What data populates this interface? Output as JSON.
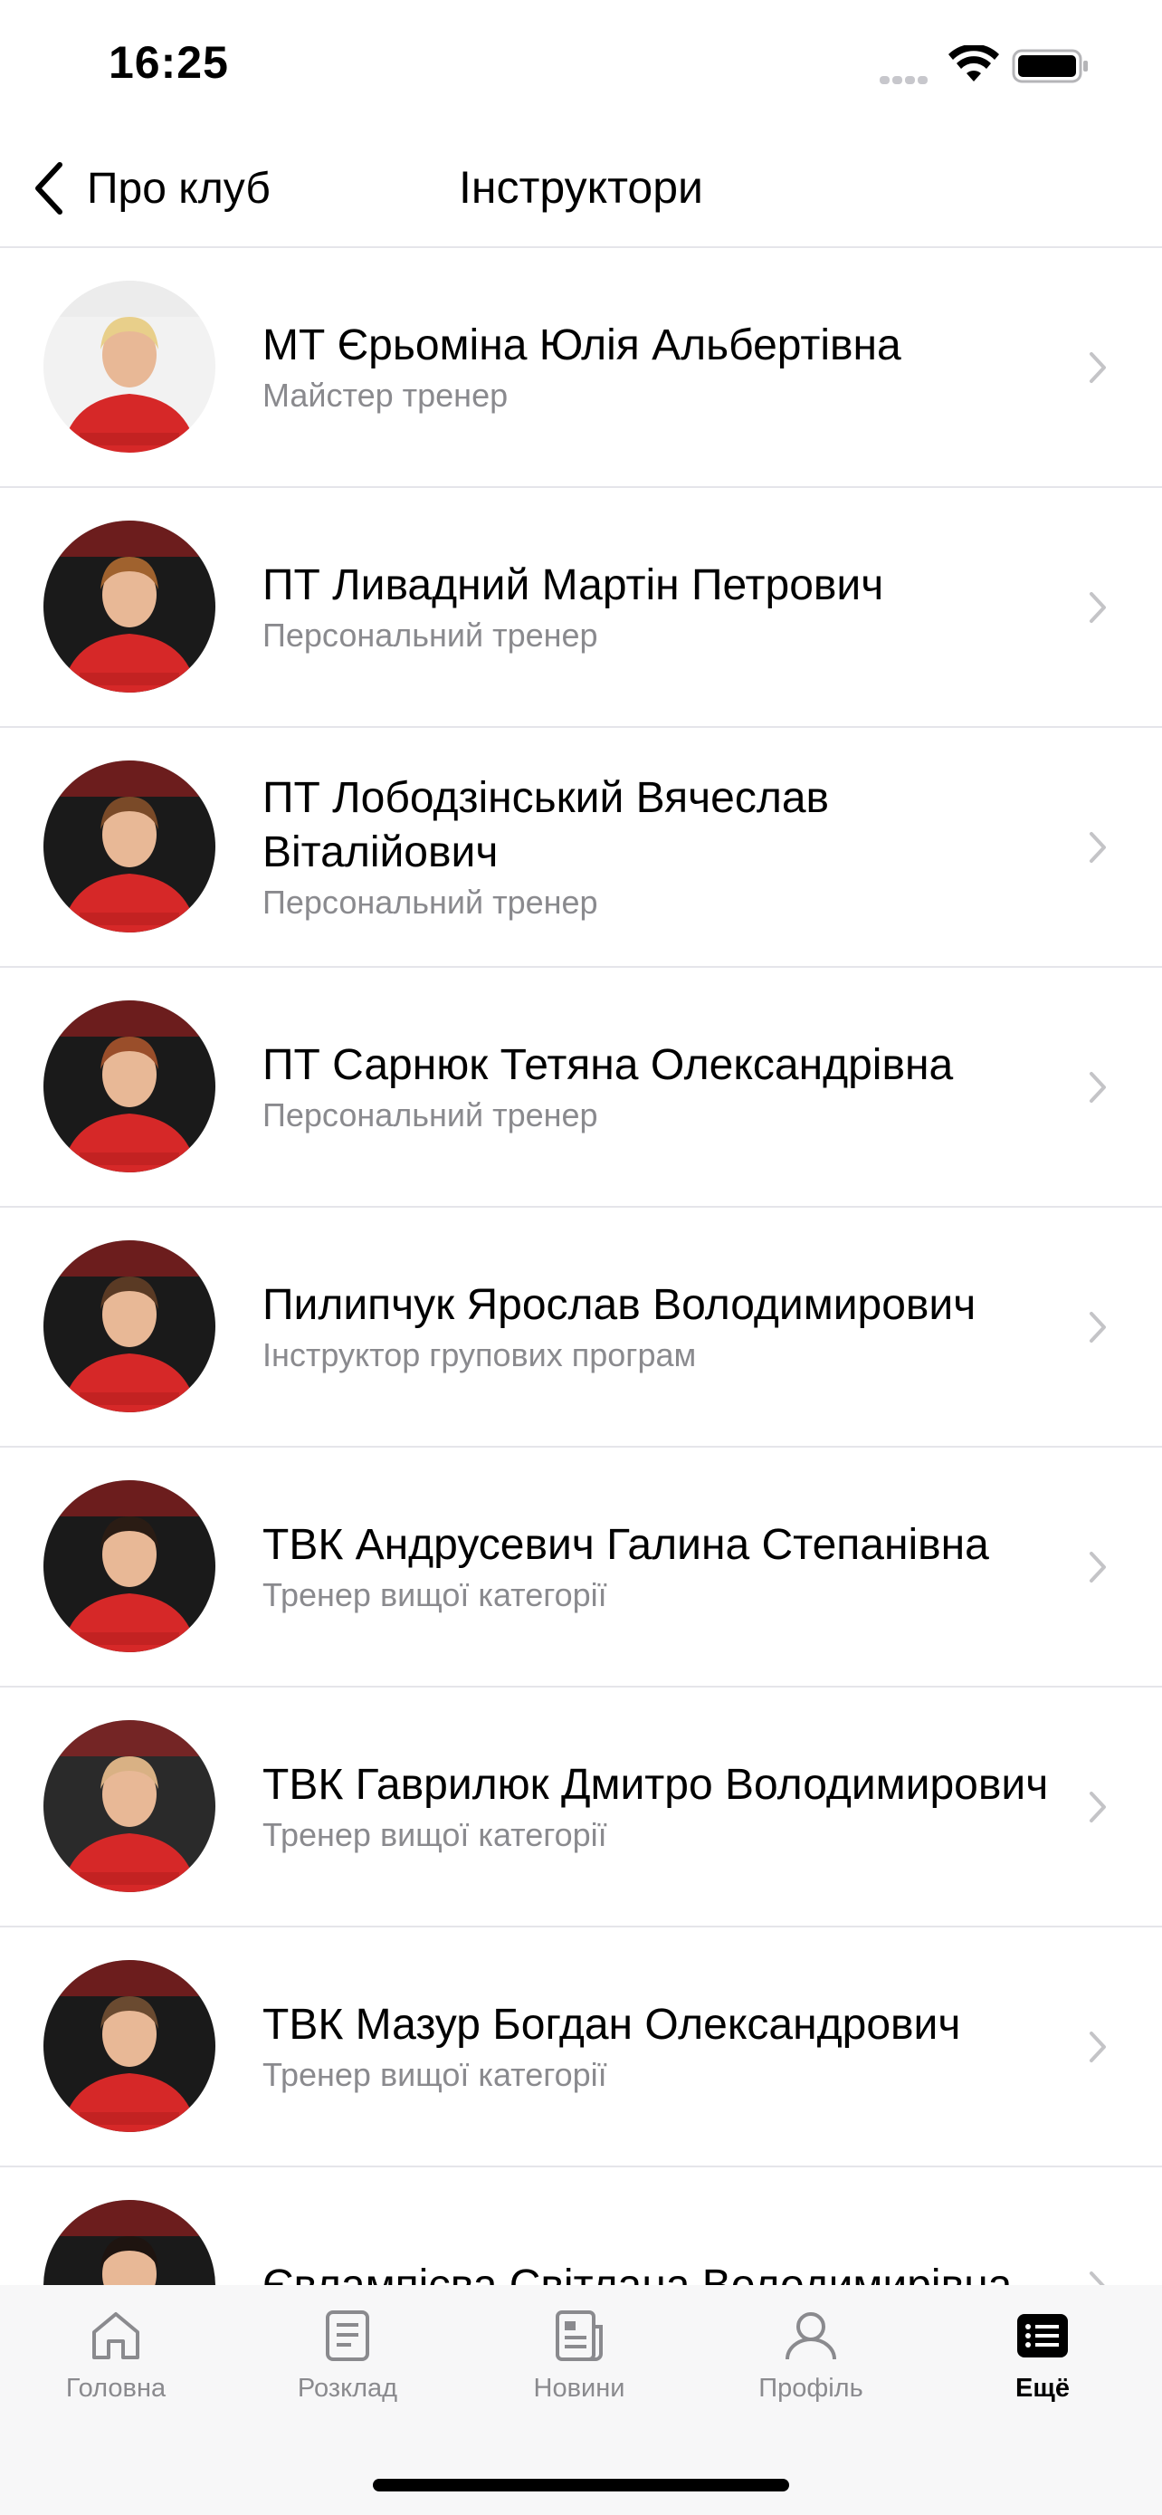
{
  "status_bar": {
    "time": "16:25"
  },
  "nav": {
    "back_label": "Про клуб",
    "title": "Інструктори"
  },
  "instructors": [
    {
      "name": "МТ Єрьоміна Юлія Альбертівна",
      "role": "Майстер тренер"
    },
    {
      "name": "ПТ Ливадний Мартін Петрович",
      "role": "Персональний тренер"
    },
    {
      "name": "ПТ Лободзінський Вячеслав Віталійович",
      "role": "Персональний тренер"
    },
    {
      "name": "ПТ Сарнюк Тетяна Олександрівна",
      "role": "Персональний тренер"
    },
    {
      "name": "Пилипчук Ярослав Володимирович",
      "role": "Інструктор групових програм"
    },
    {
      "name": "ТВК Андрусевич Галина Степанівна",
      "role": "Тренер вищої категорії"
    },
    {
      "name": "ТВК Гаврилюк Дмитро Володимирович",
      "role": "Тренер вищої категорії"
    },
    {
      "name": "ТВК Мазур Богдан Олександрович",
      "role": "Тренер вищої категорії"
    },
    {
      "name": "Євлампієва Світлана Володимирівна",
      "role": ""
    }
  ],
  "tabs": [
    {
      "label": "Головна",
      "icon": "home-icon"
    },
    {
      "label": "Розклад",
      "icon": "schedule-icon"
    },
    {
      "label": "Новини",
      "icon": "news-icon"
    },
    {
      "label": "Профіль",
      "icon": "profile-icon"
    },
    {
      "label": "Ещё",
      "icon": "more-icon"
    }
  ],
  "colors": {
    "accent": "#000000",
    "secondary_text": "#8a8a8e",
    "separator": "#e5e5ea",
    "shirt_red": "#d62828"
  }
}
